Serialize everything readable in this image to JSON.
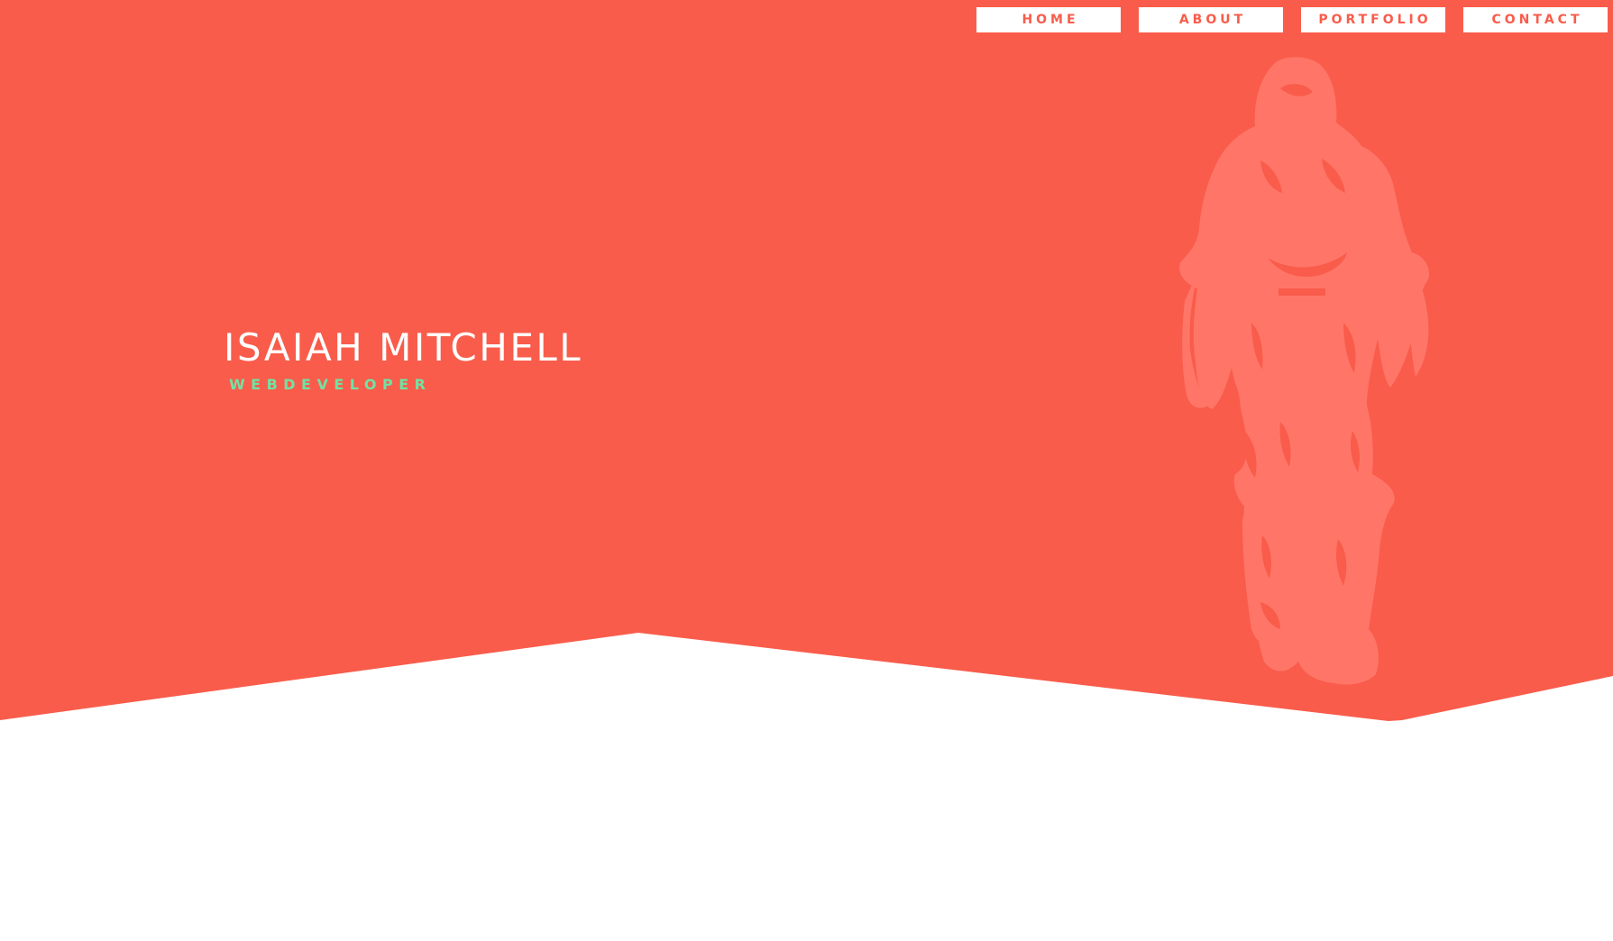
{
  "colors": {
    "hero_background": "#f95c4b",
    "page_background": "#ffffff",
    "figure_tint": "#ff7668",
    "nav_text": "#f95c4b",
    "subtitle": "#6fe3a4"
  },
  "nav": {
    "items": [
      {
        "label": "HOME"
      },
      {
        "label": "ABOUT"
      },
      {
        "label": "PORTFOLIO"
      },
      {
        "label": "CONTACT"
      }
    ]
  },
  "hero": {
    "name": "ISAIAH MITCHELL",
    "role": "WEBDEVELOPER",
    "image_icon": "hooded-person-silhouette"
  }
}
